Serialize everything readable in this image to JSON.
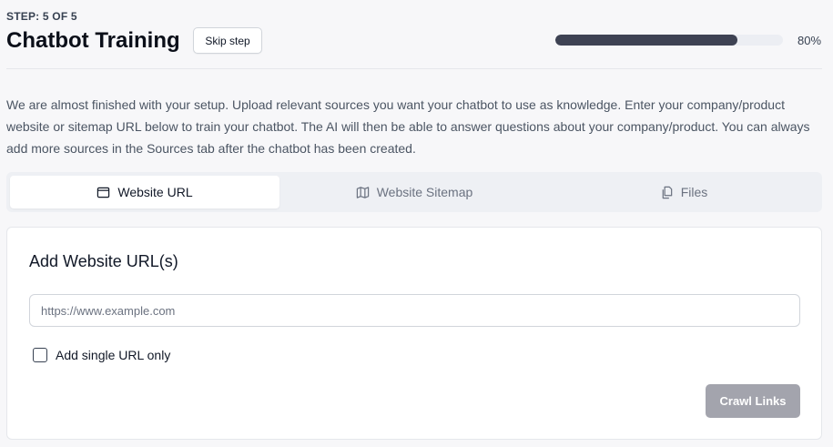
{
  "header": {
    "step_label": "STEP: 5 OF 5",
    "title": "Chatbot Training",
    "skip_label": "Skip step",
    "progress_percent": 80,
    "progress_text": "80%"
  },
  "description": "We are almost finished with your setup. Upload relevant sources you want your chatbot to use as knowledge. Enter your company/product website or sitemap URL below to train your chatbot. The AI will then be able to answer questions about your company/product. You can always add more sources in the Sources tab after the chatbot has been created.",
  "tabs": [
    {
      "label": "Website URL",
      "icon": "browser-window-icon",
      "active": true
    },
    {
      "label": "Website Sitemap",
      "icon": "map-icon",
      "active": false
    },
    {
      "label": "Files",
      "icon": "files-icon",
      "active": false
    }
  ],
  "form": {
    "title": "Add Website URL(s)",
    "url_value": "",
    "url_placeholder": "https://www.example.com",
    "single_url_label": "Add single URL only",
    "single_url_checked": false,
    "crawl_label": "Crawl Links"
  },
  "colors": {
    "progress_fill": "#3e4253",
    "crawl_button_disabled": "#a3a4ad"
  }
}
